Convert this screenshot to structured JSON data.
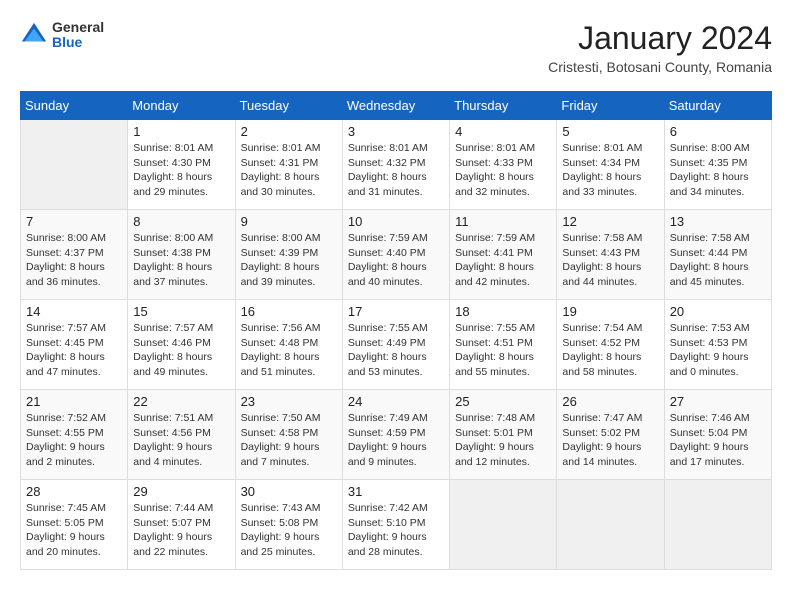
{
  "header": {
    "logo": {
      "general": "General",
      "blue": "Blue"
    },
    "title": "January 2024",
    "location": "Cristesti, Botosani County, Romania"
  },
  "days_of_week": [
    "Sunday",
    "Monday",
    "Tuesday",
    "Wednesday",
    "Thursday",
    "Friday",
    "Saturday"
  ],
  "weeks": [
    [
      {
        "day": "",
        "empty": true
      },
      {
        "day": "1",
        "sunrise": "Sunrise: 8:01 AM",
        "sunset": "Sunset: 4:30 PM",
        "daylight": "Daylight: 8 hours and 29 minutes."
      },
      {
        "day": "2",
        "sunrise": "Sunrise: 8:01 AM",
        "sunset": "Sunset: 4:31 PM",
        "daylight": "Daylight: 8 hours and 30 minutes."
      },
      {
        "day": "3",
        "sunrise": "Sunrise: 8:01 AM",
        "sunset": "Sunset: 4:32 PM",
        "daylight": "Daylight: 8 hours and 31 minutes."
      },
      {
        "day": "4",
        "sunrise": "Sunrise: 8:01 AM",
        "sunset": "Sunset: 4:33 PM",
        "daylight": "Daylight: 8 hours and 32 minutes."
      },
      {
        "day": "5",
        "sunrise": "Sunrise: 8:01 AM",
        "sunset": "Sunset: 4:34 PM",
        "daylight": "Daylight: 8 hours and 33 minutes."
      },
      {
        "day": "6",
        "sunrise": "Sunrise: 8:00 AM",
        "sunset": "Sunset: 4:35 PM",
        "daylight": "Daylight: 8 hours and 34 minutes."
      }
    ],
    [
      {
        "day": "7",
        "sunrise": "Sunrise: 8:00 AM",
        "sunset": "Sunset: 4:37 PM",
        "daylight": "Daylight: 8 hours and 36 minutes."
      },
      {
        "day": "8",
        "sunrise": "Sunrise: 8:00 AM",
        "sunset": "Sunset: 4:38 PM",
        "daylight": "Daylight: 8 hours and 37 minutes."
      },
      {
        "day": "9",
        "sunrise": "Sunrise: 8:00 AM",
        "sunset": "Sunset: 4:39 PM",
        "daylight": "Daylight: 8 hours and 39 minutes."
      },
      {
        "day": "10",
        "sunrise": "Sunrise: 7:59 AM",
        "sunset": "Sunset: 4:40 PM",
        "daylight": "Daylight: 8 hours and 40 minutes."
      },
      {
        "day": "11",
        "sunrise": "Sunrise: 7:59 AM",
        "sunset": "Sunset: 4:41 PM",
        "daylight": "Daylight: 8 hours and 42 minutes."
      },
      {
        "day": "12",
        "sunrise": "Sunrise: 7:58 AM",
        "sunset": "Sunset: 4:43 PM",
        "daylight": "Daylight: 8 hours and 44 minutes."
      },
      {
        "day": "13",
        "sunrise": "Sunrise: 7:58 AM",
        "sunset": "Sunset: 4:44 PM",
        "daylight": "Daylight: 8 hours and 45 minutes."
      }
    ],
    [
      {
        "day": "14",
        "sunrise": "Sunrise: 7:57 AM",
        "sunset": "Sunset: 4:45 PM",
        "daylight": "Daylight: 8 hours and 47 minutes."
      },
      {
        "day": "15",
        "sunrise": "Sunrise: 7:57 AM",
        "sunset": "Sunset: 4:46 PM",
        "daylight": "Daylight: 8 hours and 49 minutes."
      },
      {
        "day": "16",
        "sunrise": "Sunrise: 7:56 AM",
        "sunset": "Sunset: 4:48 PM",
        "daylight": "Daylight: 8 hours and 51 minutes."
      },
      {
        "day": "17",
        "sunrise": "Sunrise: 7:55 AM",
        "sunset": "Sunset: 4:49 PM",
        "daylight": "Daylight: 8 hours and 53 minutes."
      },
      {
        "day": "18",
        "sunrise": "Sunrise: 7:55 AM",
        "sunset": "Sunset: 4:51 PM",
        "daylight": "Daylight: 8 hours and 55 minutes."
      },
      {
        "day": "19",
        "sunrise": "Sunrise: 7:54 AM",
        "sunset": "Sunset: 4:52 PM",
        "daylight": "Daylight: 8 hours and 58 minutes."
      },
      {
        "day": "20",
        "sunrise": "Sunrise: 7:53 AM",
        "sunset": "Sunset: 4:53 PM",
        "daylight": "Daylight: 9 hours and 0 minutes."
      }
    ],
    [
      {
        "day": "21",
        "sunrise": "Sunrise: 7:52 AM",
        "sunset": "Sunset: 4:55 PM",
        "daylight": "Daylight: 9 hours and 2 minutes."
      },
      {
        "day": "22",
        "sunrise": "Sunrise: 7:51 AM",
        "sunset": "Sunset: 4:56 PM",
        "daylight": "Daylight: 9 hours and 4 minutes."
      },
      {
        "day": "23",
        "sunrise": "Sunrise: 7:50 AM",
        "sunset": "Sunset: 4:58 PM",
        "daylight": "Daylight: 9 hours and 7 minutes."
      },
      {
        "day": "24",
        "sunrise": "Sunrise: 7:49 AM",
        "sunset": "Sunset: 4:59 PM",
        "daylight": "Daylight: 9 hours and 9 minutes."
      },
      {
        "day": "25",
        "sunrise": "Sunrise: 7:48 AM",
        "sunset": "Sunset: 5:01 PM",
        "daylight": "Daylight: 9 hours and 12 minutes."
      },
      {
        "day": "26",
        "sunrise": "Sunrise: 7:47 AM",
        "sunset": "Sunset: 5:02 PM",
        "daylight": "Daylight: 9 hours and 14 minutes."
      },
      {
        "day": "27",
        "sunrise": "Sunrise: 7:46 AM",
        "sunset": "Sunset: 5:04 PM",
        "daylight": "Daylight: 9 hours and 17 minutes."
      }
    ],
    [
      {
        "day": "28",
        "sunrise": "Sunrise: 7:45 AM",
        "sunset": "Sunset: 5:05 PM",
        "daylight": "Daylight: 9 hours and 20 minutes."
      },
      {
        "day": "29",
        "sunrise": "Sunrise: 7:44 AM",
        "sunset": "Sunset: 5:07 PM",
        "daylight": "Daylight: 9 hours and 22 minutes."
      },
      {
        "day": "30",
        "sunrise": "Sunrise: 7:43 AM",
        "sunset": "Sunset: 5:08 PM",
        "daylight": "Daylight: 9 hours and 25 minutes."
      },
      {
        "day": "31",
        "sunrise": "Sunrise: 7:42 AM",
        "sunset": "Sunset: 5:10 PM",
        "daylight": "Daylight: 9 hours and 28 minutes."
      },
      {
        "day": "",
        "empty": true
      },
      {
        "day": "",
        "empty": true
      },
      {
        "day": "",
        "empty": true
      }
    ]
  ]
}
